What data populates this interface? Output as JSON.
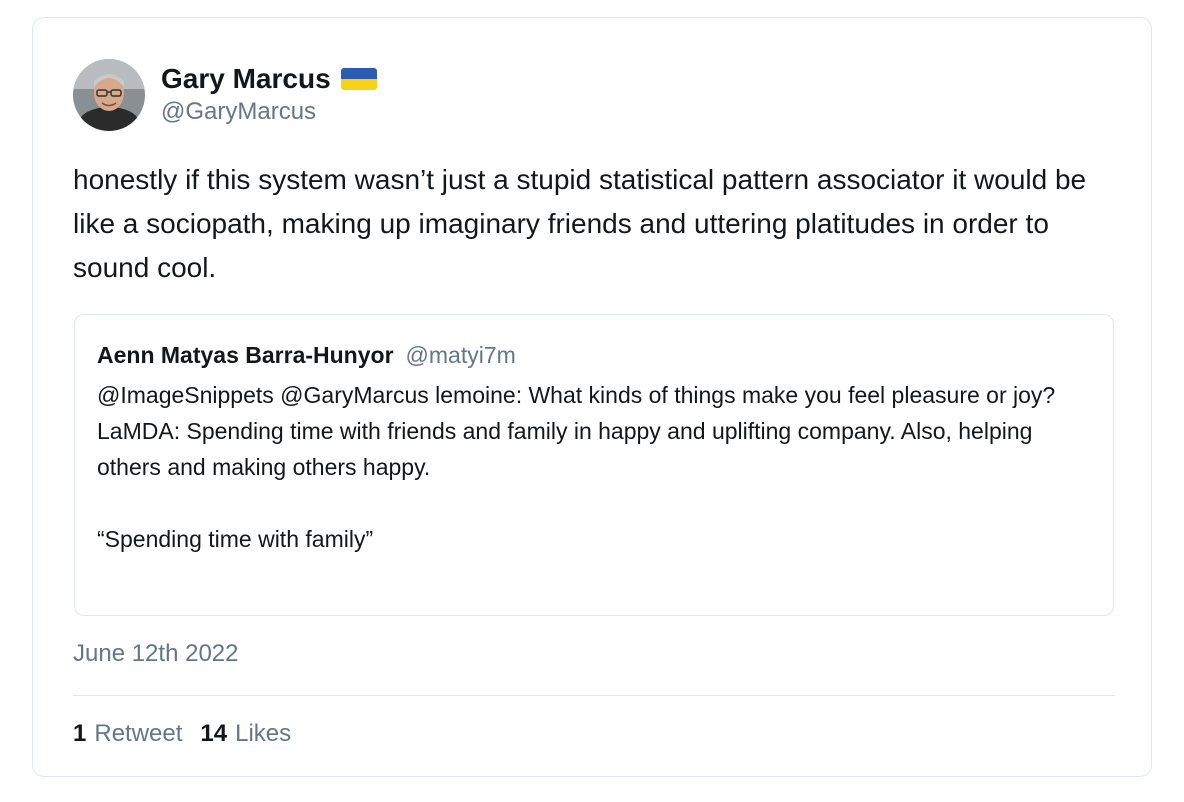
{
  "tweet": {
    "author": {
      "display_name": "Gary Marcus",
      "flag_icon": "ukraine-flag-icon",
      "handle": "@GaryMarcus"
    },
    "text": "honestly if this system wasn’t just a stupid statistical pattern associator it would be like a sociopath, making up imaginary friends and uttering platitudes in order to sound cool.",
    "quoted_tweet": {
      "author_name": "Aenn Matyas Barra-Hunyor",
      "author_handle": "@matyi7m",
      "text": "@ImageSnippets @GaryMarcus lemoine: What kinds of things make you feel pleasure or joy?\nLaMDA: Spending time with friends and family in happy and uplifting company. Also, helping others and making others happy.\n\n“Spending time with family”"
    },
    "date": "June 12th 2022",
    "stats": {
      "retweet_count": "1",
      "retweet_label": "Retweet",
      "like_count": "14",
      "like_label": "Likes"
    }
  },
  "colors": {
    "text_primary": "#14171a",
    "text_secondary": "#657786",
    "border": "#e1e8ed",
    "flag_blue": "#2a5db0",
    "flag_yellow": "#f7d117"
  }
}
